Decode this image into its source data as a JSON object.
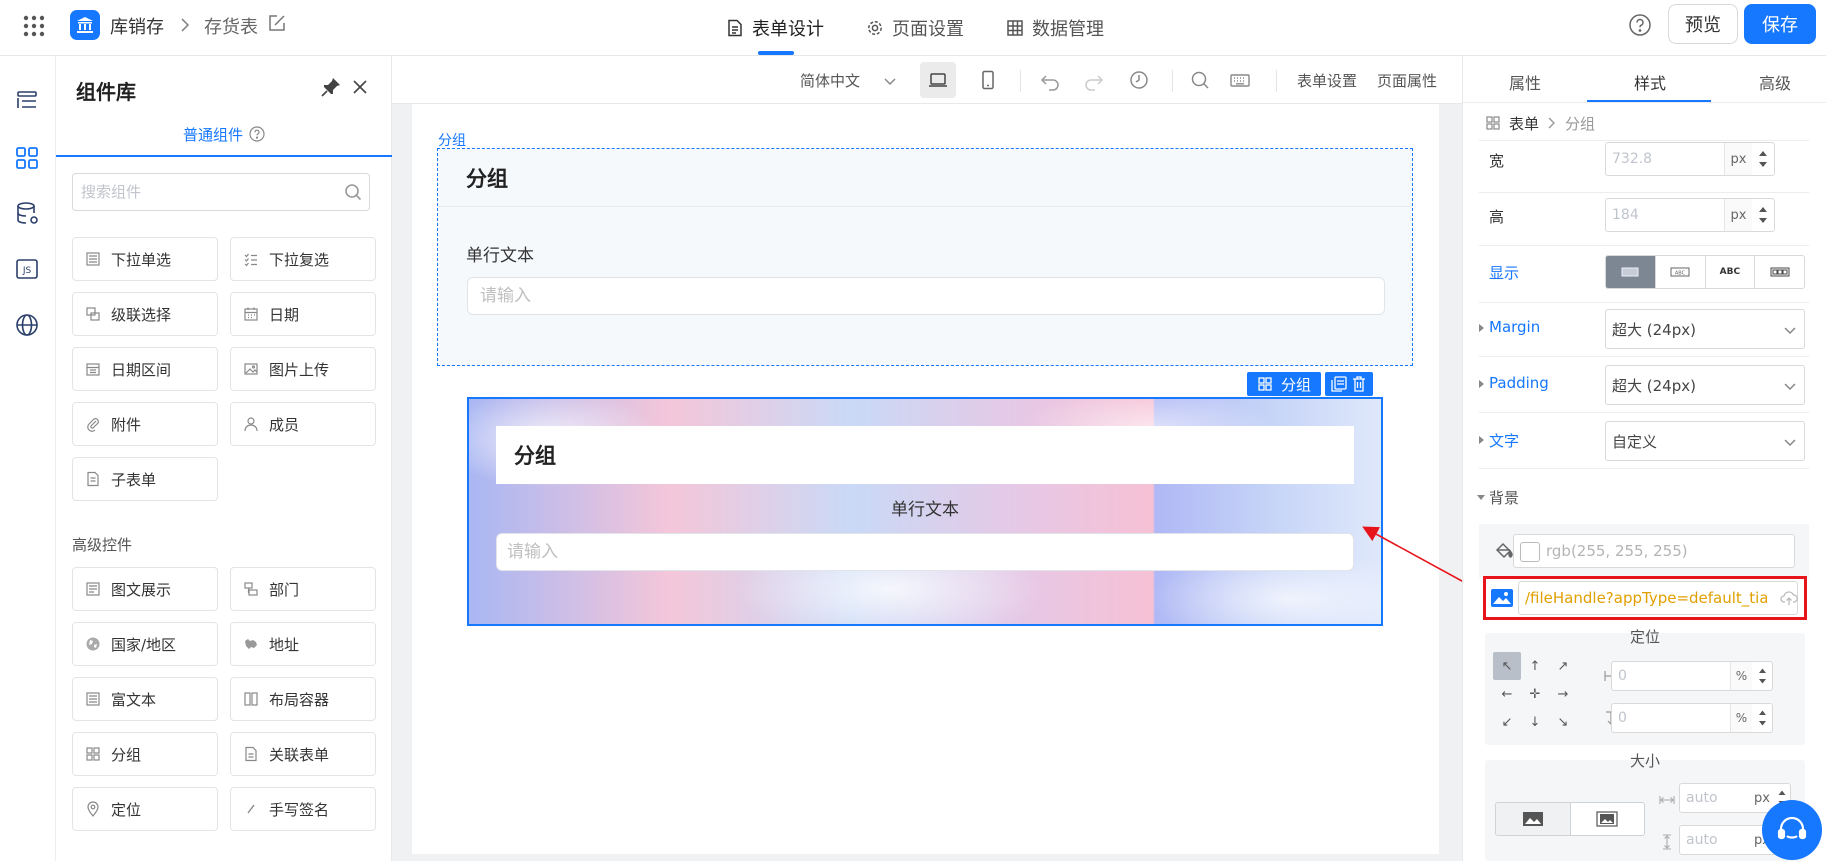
{
  "app": {
    "name": "库销存",
    "page": "存货表"
  },
  "top_tabs": [
    {
      "label": "表单设计",
      "icon": "document-icon"
    },
    {
      "label": "页面设置",
      "icon": "gear-icon"
    },
    {
      "label": "数据管理",
      "icon": "table-icon"
    }
  ],
  "actions": {
    "preview": "预览",
    "save": "保存"
  },
  "component_panel": {
    "title": "组件库",
    "tab": "普通组件",
    "search_placeholder": "搜索组件",
    "basic": [
      "下拉单选",
      "下拉复选",
      "级联选择",
      "日期",
      "日期区间",
      "图片上传",
      "附件",
      "成员",
      "子表单"
    ],
    "advanced_label": "高级控件",
    "advanced": [
      "图文展示",
      "部门",
      "国家/地区",
      "地址",
      "富文本",
      "布局容器",
      "分组",
      "关联表单",
      "定位",
      "手写签名"
    ]
  },
  "toolbar": {
    "language": "简体中文",
    "form_settings": "表单设置",
    "page_props": "页面属性"
  },
  "canvas": {
    "group1": {
      "tag": "分组",
      "title": "分组",
      "field_label": "单行文本",
      "placeholder": "请输入"
    },
    "group2": {
      "tag": "分组",
      "title": "分组",
      "field_label": "单行文本",
      "placeholder": "请输入"
    }
  },
  "right_panel": {
    "tabs": [
      "属性",
      "样式",
      "高级"
    ],
    "active_tab": "样式",
    "breadcrumb": [
      "表单",
      "分组"
    ],
    "width": {
      "label": "宽",
      "value": "732.8",
      "unit": "px"
    },
    "height": {
      "label": "高",
      "value": "184",
      "unit": "px"
    },
    "display": {
      "label": "显示",
      "options": [
        "ABC",
        "ABC"
      ]
    },
    "margin": {
      "label": "Margin",
      "value": "超大 (24px)"
    },
    "padding": {
      "label": "Padding",
      "value": "超大 (24px)"
    },
    "text": {
      "label": "文字",
      "value": "自定义"
    },
    "background": {
      "label": "背景",
      "color": "rgb(255, 255, 255)",
      "image_url": "/fileHandle?appType=default_tia"
    },
    "position": {
      "label": "定位",
      "x": "0",
      "y": "0",
      "unit": "%"
    },
    "size": {
      "label": "大小",
      "width": "auto",
      "height": "auto",
      "unit": "px"
    }
  },
  "colors": {
    "primary": "#1677ff",
    "highlight": "#e8141b",
    "url_text": "#e2a000"
  }
}
